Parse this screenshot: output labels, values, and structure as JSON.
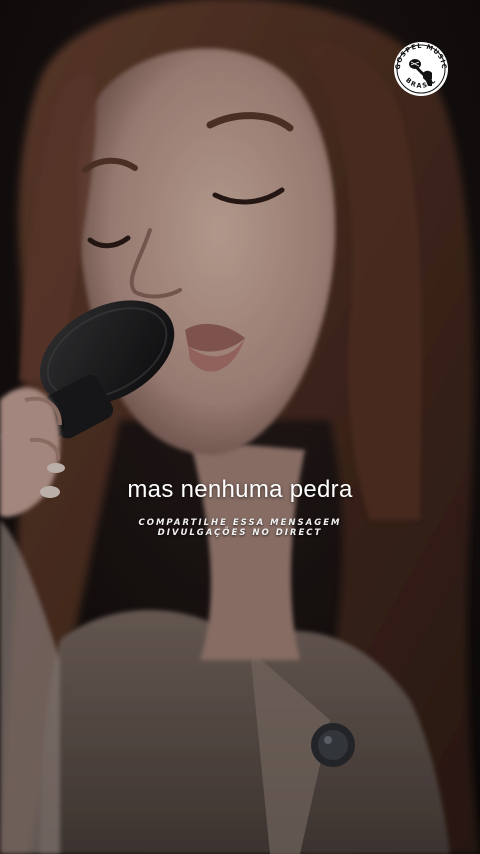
{
  "caption": {
    "lyric": "mas nenhuma pedra"
  },
  "subtext": {
    "line1": "COMPARTILHE ESSA MENSAGEM",
    "line2": "DIVULGAÇÕES NO DIRECT"
  },
  "logo": {
    "icon": "microphone-fist-icon",
    "text_top": "GOSPEL MUSIC",
    "text_bottom": "BRASIL"
  },
  "colors": {
    "caption_text": "#ffffff",
    "background": "#0d0a0a",
    "hair": "#5a3526",
    "skin": "#c9a898"
  }
}
